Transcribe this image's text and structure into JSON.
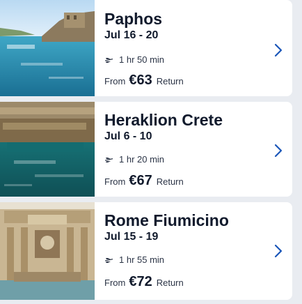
{
  "destinations": [
    {
      "title": "Paphos",
      "dates": "Jul 16 - 20",
      "duration": "1 hr 50 min",
      "price_prefix": "From",
      "price": "€63",
      "price_suffix": "Return",
      "icon": "chevron-right-icon"
    },
    {
      "title": "Heraklion Crete",
      "dates": "Jul 6 - 10",
      "duration": "1 hr 20 min",
      "price_prefix": "From",
      "price": "€67",
      "price_suffix": "Return",
      "icon": "chevron-right-icon"
    },
    {
      "title": "Rome Fiumicino",
      "dates": "Jul 15 - 19",
      "duration": "1 hr 55 min",
      "price_prefix": "From",
      "price": "€72",
      "price_suffix": "Return",
      "icon": "chevron-right-icon"
    }
  ],
  "colors": {
    "chevron": "#1a56b8",
    "text": "#111a2c",
    "background": "#e9ecf1"
  }
}
